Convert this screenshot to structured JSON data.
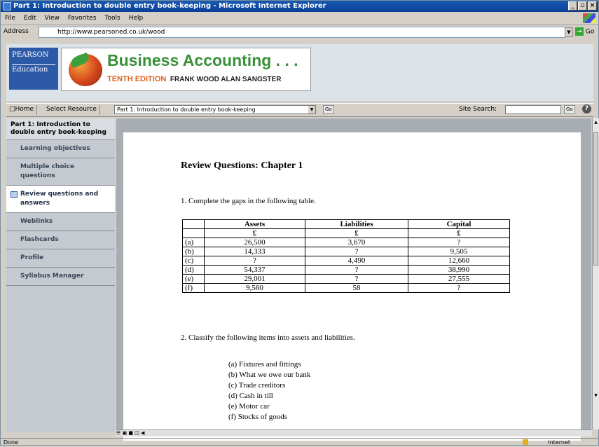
{
  "window": {
    "title": "Part 1: Introduction to double entry book-keeping - Microsoft Internet Explorer"
  },
  "menu": [
    "File",
    "Edit",
    "View",
    "Favorites",
    "Tools",
    "Help"
  ],
  "address": {
    "label": "Address",
    "url": "http://www.pearsoned.co.uk/wood",
    "go": "Go"
  },
  "banner": {
    "publisher_top": "PEARSON",
    "publisher_bottom": "Education",
    "title": "Business Accounting . . .",
    "edition": "TENTH EDITION",
    "authors": "FRANK WOOD  ALAN SANGSTER"
  },
  "nav": {
    "home": "Home",
    "select_resource": "Select Resource",
    "resource_value": "Part 1: Introduction to double entry book-keeping",
    "go": "Go",
    "site_search": "Site Search:",
    "search_go": "Go",
    "help": "?"
  },
  "sidebar": {
    "heading": "Part 1: Introduction to double entry book-keeping",
    "items": [
      {
        "label": "Learning objectives"
      },
      {
        "label": "Multiple choice questions"
      },
      {
        "label": "Review questions and answers"
      },
      {
        "label": "Weblinks"
      },
      {
        "label": "Flashcards"
      },
      {
        "label": "Profile"
      },
      {
        "label": "Syllabus Manager"
      }
    ]
  },
  "doc": {
    "heading": "Review Questions: Chapter 1",
    "q1": "1. Complete the gaps in the following table.",
    "table": {
      "headers": [
        "",
        "Assets",
        "Liabilities",
        "Capital"
      ],
      "currency": [
        "",
        "£",
        "£",
        "£"
      ],
      "rows": [
        [
          "(a)",
          "26,500",
          "3,670",
          "?"
        ],
        [
          "(b)",
          "14,333",
          "?",
          "9,505"
        ],
        [
          "(c)",
          "?",
          "4,490",
          "12,660"
        ],
        [
          "(d)",
          "54,337",
          "?",
          "38,990"
        ],
        [
          "(e)",
          "29,001",
          "?",
          "27,555"
        ],
        [
          "(f)",
          "9,560",
          "58",
          "?"
        ]
      ]
    },
    "q2": "2. Classify the following items into assets and liabilities.",
    "q2_items": [
      "(a) Fixtures and fittings",
      "(b) What we owe our bank",
      "(c) Trade creditors",
      "(d) Cash in till",
      "(e) Motor car",
      "(f) Stocks of goods"
    ]
  },
  "status": {
    "text": "Done",
    "zone": "Internet"
  }
}
